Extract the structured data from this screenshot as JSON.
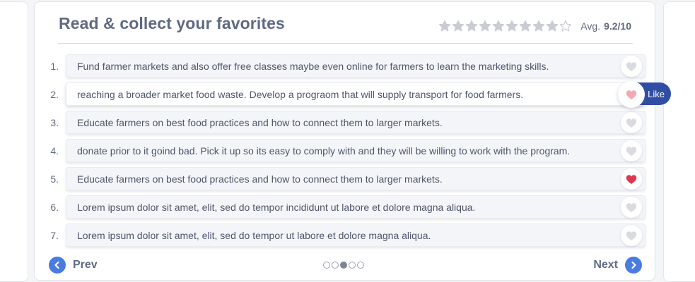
{
  "header": {
    "title": "Read & collect your favorites",
    "rating": {
      "avg_label": "Avg.",
      "avg_value": "9.2/10",
      "stars_filled": 9,
      "stars_total": 10,
      "star_color": "#c9ccd3"
    }
  },
  "items": [
    {
      "num": "1.",
      "text": "Fund farmer markets and also offer free classes maybe even online for farmers to learn the marketing skills.",
      "liked": false
    },
    {
      "num": "2.",
      "text": "reaching a broader market food waste. Develop a prograom that will supply transport for food farmers.",
      "liked": false,
      "hover": true
    },
    {
      "num": "3.",
      "text": "Educate farmers on best food practices and how to connect them to larger markets.",
      "liked": false
    },
    {
      "num": "4.",
      "text": "donate prior to it goind bad. Pick it up so its easy to comply with and they will be willing to work with the program.",
      "liked": false
    },
    {
      "num": "5.",
      "text": "Educate farmers on best food practices and how to connect them to larger markets.",
      "liked": true
    },
    {
      "num": "6.",
      "text": "Lorem ipsum dolor sit amet, elit, sed do tempor incididunt ut labore et dolore magna aliqua.",
      "liked": false
    },
    {
      "num": "7.",
      "text": "Lorem ipsum dolor sit amet, elit, sed do tempor ut labore et dolore magna aliqua.",
      "liked": false
    }
  ],
  "tooltip": {
    "like_label": "Like"
  },
  "footer": {
    "prev_label": "Prev",
    "next_label": "Next",
    "page_count": 5,
    "current_page": 3
  },
  "colors": {
    "accent": "#4a7be0",
    "tooltip_bg": "#2f4ea4",
    "heart_liked": "#e0374f",
    "heart_hover": "#f2a9b2",
    "heart_empty": "#d9dbe0"
  }
}
